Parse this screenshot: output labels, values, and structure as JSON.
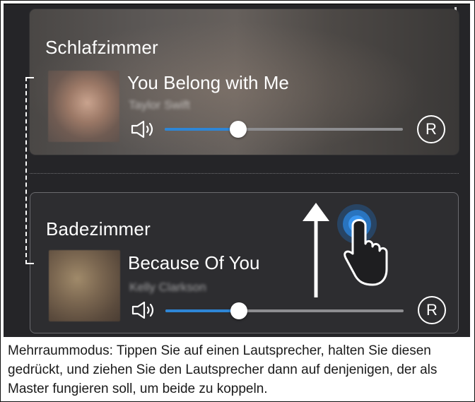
{
  "description_text": "Mehrraummodus: Tippen Sie auf einen Lautsprecher, halten Sie diesen gedrückt, und ziehen Sie den Lautsprecher dann auf denjenigen, der als Master fungieren soll, um beide zu koppeln.",
  "rooms": [
    {
      "name": "Schlafzimmer",
      "song": "You Belong with Me",
      "artist": "Taylor Swift",
      "volume": 0.31,
      "repeat_label": "R"
    },
    {
      "name": "Badezimmer",
      "song": "Because Of You",
      "artist": "Kelly Clarkson",
      "volume": 0.31,
      "repeat_label": "R"
    }
  ],
  "icons": {
    "volume": "speaker-icon",
    "gesture_arrow": "arrow-up-icon",
    "gesture_hand": "hand-tap-icon"
  },
  "colors": {
    "accent": "#2e86d6",
    "background": "#252528",
    "card_border": "#6a6a6e"
  }
}
